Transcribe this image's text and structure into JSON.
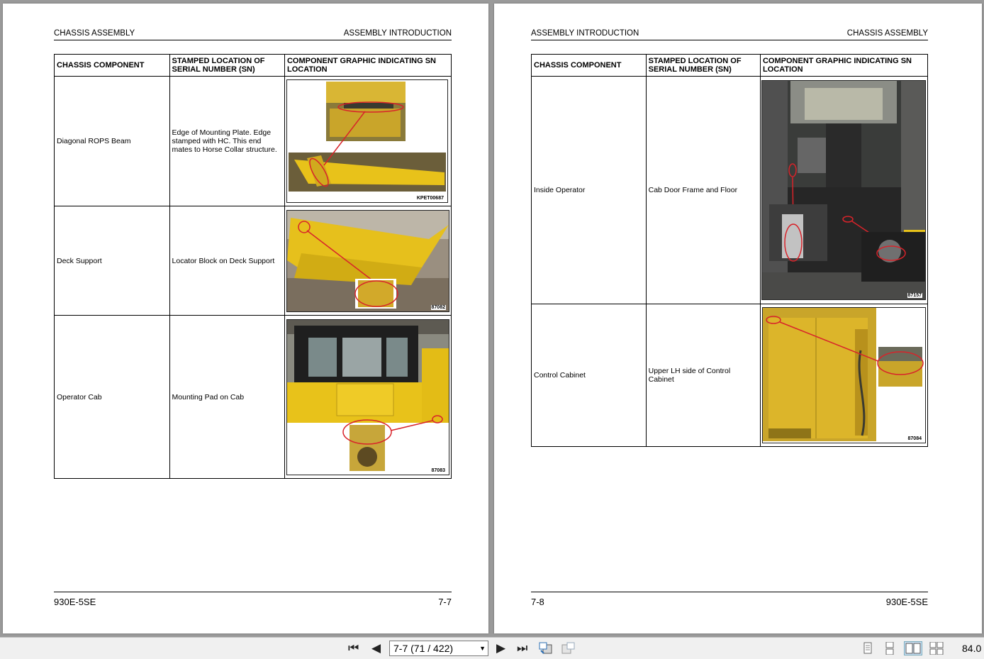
{
  "left_page": {
    "header_left": "CHASSIS ASSEMBLY",
    "header_right": "ASSEMBLY INTRODUCTION",
    "table": {
      "headers": [
        "CHASSIS COMPONENT",
        "STAMPED LOCATION OF SERIAL NUMBER (SN)",
        "COMPONENT GRAPHIC INDICATING SN LOCATION"
      ],
      "rows": [
        {
          "component": "Diagonal ROPS Beam",
          "location": "Edge of Mounting Plate. Edge stamped with HC. This end mates to Horse Collar structure.",
          "figure_id": "KPET00687"
        },
        {
          "component": "Deck Support",
          "location": "Locator Block on Deck Support",
          "figure_id": "87082"
        },
        {
          "component": "Operator Cab",
          "location": "Mounting Pad on Cab",
          "figure_id": "87083"
        }
      ]
    },
    "footer_left": "930E-5SE",
    "footer_right": "7-7"
  },
  "right_page": {
    "header_left": "ASSEMBLY INTRODUCTION",
    "header_right": "CHASSIS ASSEMBLY",
    "table": {
      "headers": [
        "CHASSIS COMPONENT",
        "STAMPED LOCATION OF SERIAL NUMBER (SN)",
        "COMPONENT GRAPHIC INDICATING SN LOCATION"
      ],
      "rows": [
        {
          "component": "Inside Operator",
          "location": "Cab Door Frame and Floor",
          "figure_id": "87157"
        },
        {
          "component": "Control Cabinet",
          "location": "Upper LH side of Control Cabinet",
          "figure_id": "87084"
        }
      ]
    },
    "footer_left": "7-8",
    "footer_right": "930E-5SE"
  },
  "toolbar": {
    "page_indicator": "7-7 (71 / 422)",
    "zoom": "84.0",
    "icons": [
      "first-page-icon",
      "previous-page-icon",
      "next-page-icon",
      "last-page-icon",
      "previous-view-icon",
      "next-view-icon",
      "single-page-view-icon",
      "continuous-view-icon",
      "facing-view-icon",
      "continuous-facing-view-icon"
    ]
  },
  "colors": {
    "machine_yellow": "#e8c21a",
    "marker_red": "#d8232a",
    "background": "#9a9a9a"
  }
}
